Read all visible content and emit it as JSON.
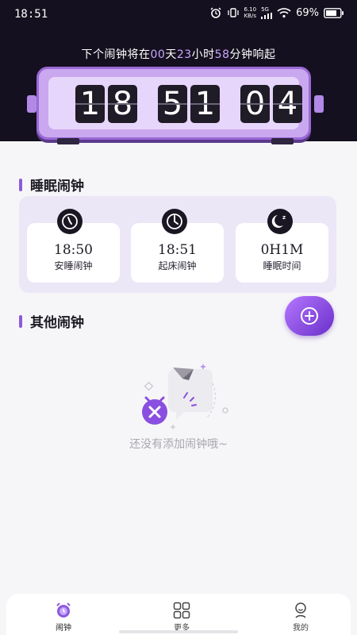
{
  "status_bar": {
    "time": "18:51",
    "net_speed_value": "6.10",
    "net_speed_unit": "KB/s",
    "network": "5G",
    "battery": "69%"
  },
  "countdown": {
    "prefix": "下个闹钟将在",
    "days": "00",
    "days_unit": "天",
    "hours": "23",
    "hours_unit": "小时",
    "minutes": "58",
    "minutes_unit": "分钟响起"
  },
  "flip_clock": {
    "digits": [
      "1",
      "8",
      "5",
      "1",
      "0",
      "4"
    ]
  },
  "sleep_section": {
    "title": "睡眠闹钟",
    "cards": [
      {
        "value": "18:50",
        "label": "安睡闹钟",
        "icon": "clock-icon"
      },
      {
        "value": "18:51",
        "label": "起床闹钟",
        "icon": "clock-icon"
      },
      {
        "value": "0H1M",
        "label": "睡眠时间",
        "icon": "moon-sleep-icon"
      }
    ]
  },
  "other_section": {
    "title": "其他闹钟",
    "empty_text": "还没有添加闹钟哦~"
  },
  "bottom_nav": {
    "items": [
      {
        "label": "闹钟",
        "icon": "alarm-clock-icon",
        "active": true
      },
      {
        "label": "更多",
        "icon": "grid-icon",
        "active": false
      },
      {
        "label": "我的",
        "icon": "profile-icon",
        "active": false
      }
    ]
  },
  "colors": {
    "accent": "#8c5ad9",
    "header_bg": "#15101f",
    "clock_body": "#caa8ef"
  }
}
